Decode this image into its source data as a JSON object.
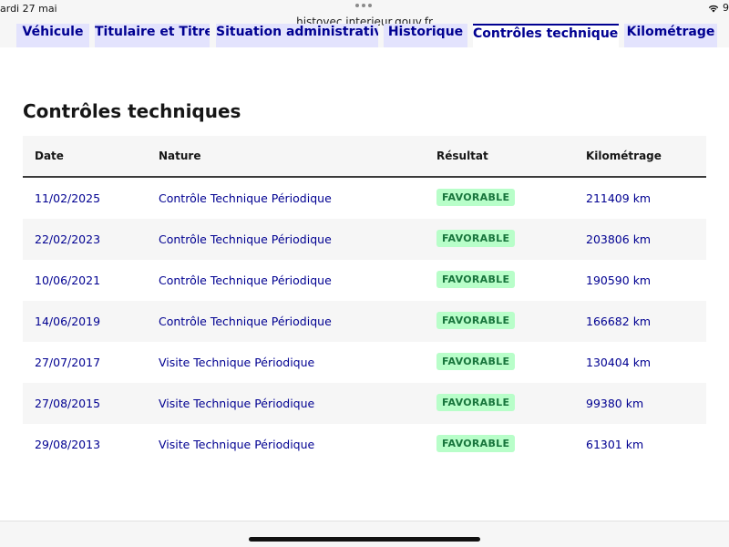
{
  "status_bar": {
    "time": "ardi 27 mai",
    "battery": "9"
  },
  "browser": {
    "url": "histovec.interieur.gouv.fr"
  },
  "tabs": [
    {
      "label": "Véhicule",
      "active": false
    },
    {
      "label": "Titulaire et Titre",
      "active": false
    },
    {
      "label": "Situation administrative",
      "active": false
    },
    {
      "label": "Historique",
      "active": false
    },
    {
      "label": "Contrôles techniques",
      "active": true
    },
    {
      "label": "Kilométrage",
      "active": false
    }
  ],
  "main": {
    "title": "Contrôles techniques",
    "table": {
      "headers": {
        "date": "Date",
        "nature": "Nature",
        "result": "Résultat",
        "km": "Kilométrage"
      },
      "rows": [
        {
          "date": "11/02/2025",
          "nature": "Contrôle Technique Périodique",
          "result": "FAVORABLE",
          "km": "211409 km"
        },
        {
          "date": "22/02/2023",
          "nature": "Contrôle Technique Périodique",
          "result": "FAVORABLE",
          "km": "203806 km"
        },
        {
          "date": "10/06/2021",
          "nature": "Contrôle Technique Périodique",
          "result": "FAVORABLE",
          "km": "190590 km"
        },
        {
          "date": "14/06/2019",
          "nature": "Contrôle Technique Périodique",
          "result": "FAVORABLE",
          "km": "166682 km"
        },
        {
          "date": "27/07/2017",
          "nature": "Visite Technique Périodique",
          "result": "FAVORABLE",
          "km": "130404 km"
        },
        {
          "date": "27/08/2015",
          "nature": "Visite Technique Périodique",
          "result": "FAVORABLE",
          "km": "99380 km"
        },
        {
          "date": "29/08/2013",
          "nature": "Visite Technique Périodique",
          "result": "FAVORABLE",
          "km": "61301 km"
        }
      ]
    }
  },
  "colors": {
    "accent": "#000091",
    "tab_bg": "#e3e3fd",
    "badge_bg": "#b8fec9",
    "badge_text": "#18753c"
  }
}
